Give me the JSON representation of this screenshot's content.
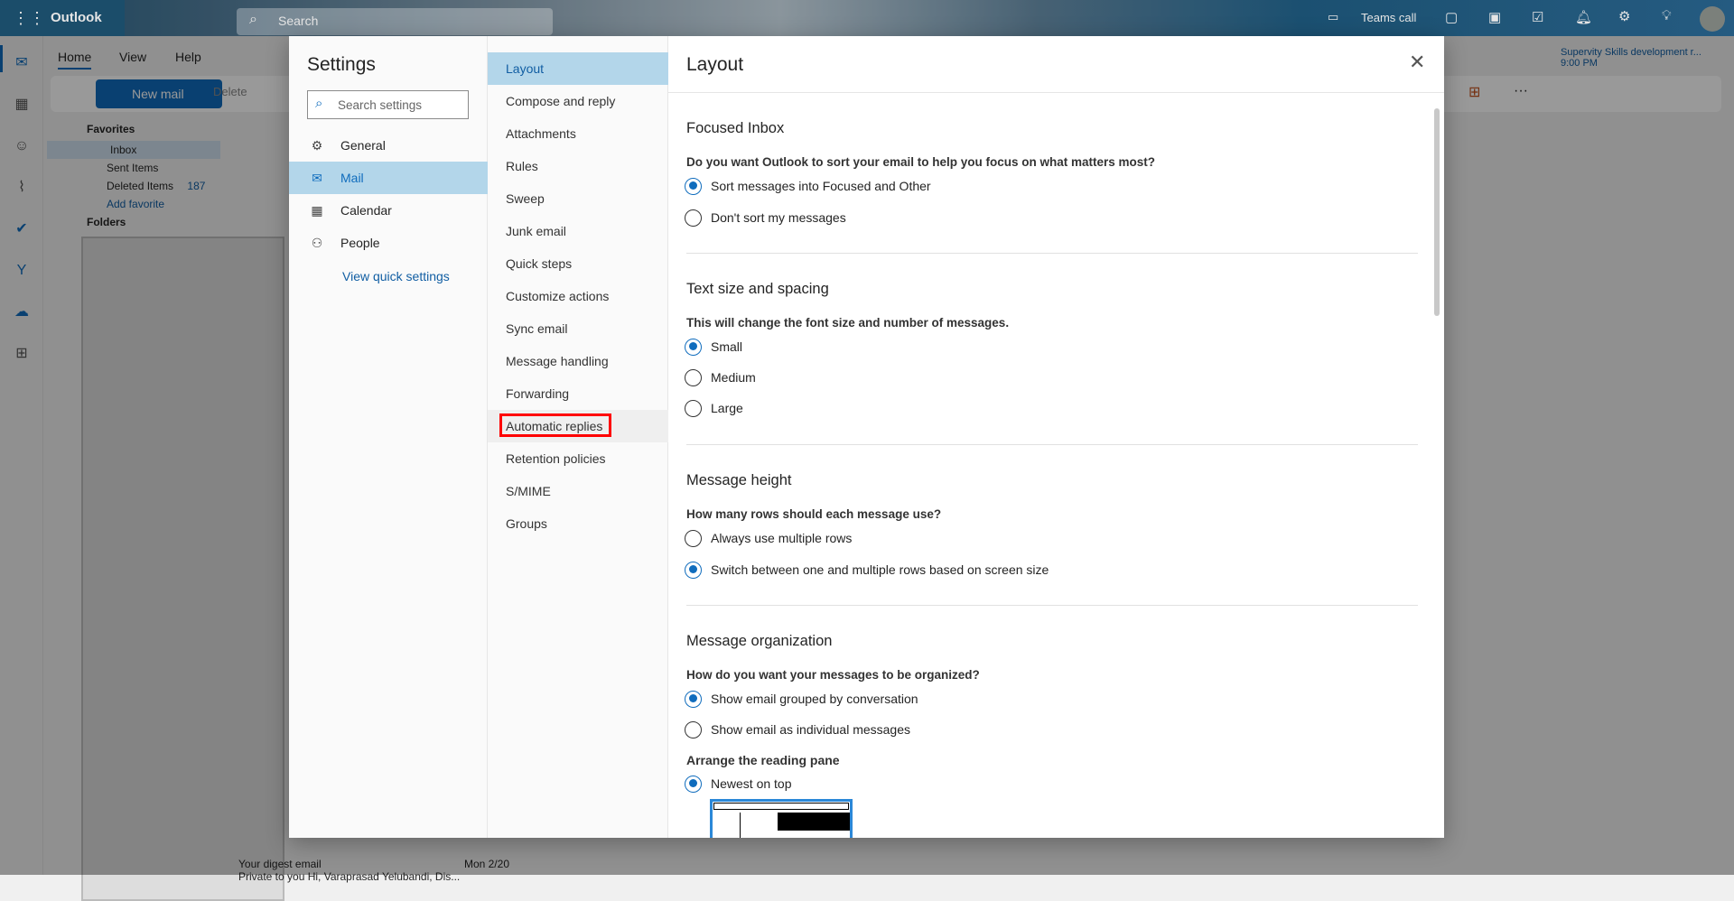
{
  "topbar": {
    "app_name": "Outlook",
    "search_placeholder": "Search",
    "teams_call": "Teams call"
  },
  "ribbon": {
    "tabs": [
      "Home",
      "View",
      "Help"
    ],
    "new_mail": "New mail",
    "delete": "Delete"
  },
  "reminder": {
    "title": "Supervity Skills development r...",
    "time": "9:00 PM"
  },
  "folders": {
    "favorites": "Favorites",
    "inbox": "Inbox",
    "sent": "Sent Items",
    "deleted": "Deleted Items",
    "deleted_count": "187",
    "add_favorite": "Add favorite",
    "folders": "Folders"
  },
  "message_list": {
    "last_subject": "Your digest email",
    "last_date": "Mon 2/20",
    "last_preview": "Private to you Hi, Varaprasad Yelubandi, Dis..."
  },
  "settings": {
    "title": "Settings",
    "search_placeholder": "Search settings",
    "nav": [
      {
        "label": "General",
        "icon": "gear-icon"
      },
      {
        "label": "Mail",
        "icon": "mail-icon"
      },
      {
        "label": "Calendar",
        "icon": "calendar-icon"
      },
      {
        "label": "People",
        "icon": "people-icon"
      }
    ],
    "quick_settings": "View quick settings",
    "mail_sections": [
      "Layout",
      "Compose and reply",
      "Attachments",
      "Rules",
      "Sweep",
      "Junk email",
      "Quick steps",
      "Customize actions",
      "Sync email",
      "Message handling",
      "Forwarding",
      "Automatic replies",
      "Retention policies",
      "S/MIME",
      "Groups"
    ],
    "selected_section": "Layout",
    "highlighted_section": "Automatic replies"
  },
  "layout": {
    "title": "Layout",
    "focused": {
      "heading": "Focused Inbox",
      "question": "Do you want Outlook to sort your email to help you focus on what matters most?",
      "options": [
        "Sort messages into Focused and Other",
        "Don't sort my messages"
      ],
      "selected": 0
    },
    "text_size": {
      "heading": "Text size and spacing",
      "question": "This will change the font size and number of messages.",
      "options": [
        "Small",
        "Medium",
        "Large"
      ],
      "selected": 0
    },
    "height": {
      "heading": "Message height",
      "question": "How many rows should each message use?",
      "options": [
        "Always use multiple rows",
        "Switch between one and multiple rows based on screen size"
      ],
      "selected": 1
    },
    "org": {
      "heading": "Message organization",
      "question": "How do you want your messages to be organized?",
      "options": [
        "Show email grouped by conversation",
        "Show email as individual messages"
      ],
      "selected": 0
    },
    "reading": {
      "heading": "Arrange the reading pane",
      "options": [
        "Newest on top"
      ],
      "selected": 0
    }
  },
  "colors": {
    "accent": "#0f6cbd",
    "selected_bg": "#b3d6ea",
    "highlight_box": "#ff0000"
  }
}
